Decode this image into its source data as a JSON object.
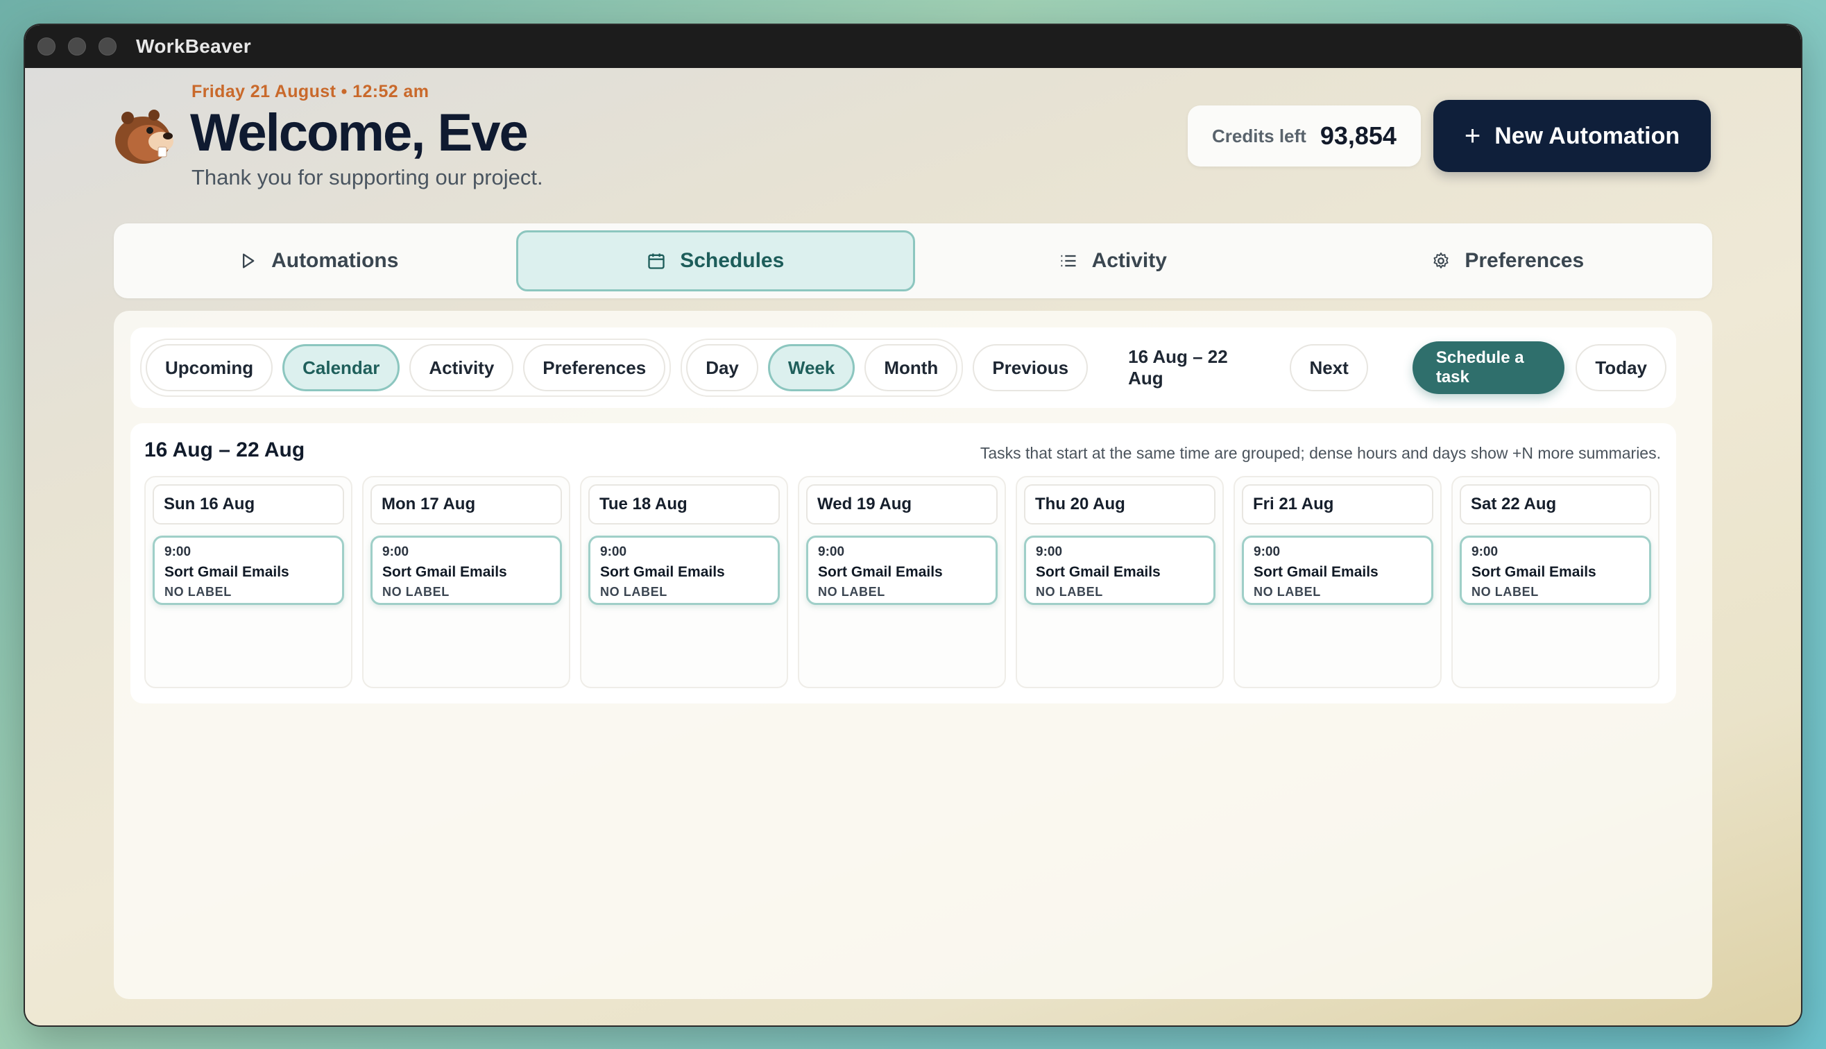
{
  "window": {
    "title": "WorkBeaver"
  },
  "header": {
    "date_line": "Friday 21 August • 12:52 am",
    "welcome": "Welcome, Eve",
    "subtitle": "Thank you for supporting our project.",
    "credits_label": "Credits left",
    "credits_value": "93,854",
    "new_automation_label": "New Automation"
  },
  "main_tabs": [
    {
      "label": "Automations",
      "icon": "play-icon"
    },
    {
      "label": "Schedules",
      "icon": "calendar-icon",
      "active": true
    },
    {
      "label": "Activity",
      "icon": "list-icon"
    },
    {
      "label": "Preferences",
      "icon": "gear-icon"
    }
  ],
  "toolbar": {
    "sub_tabs": [
      "Upcoming",
      "Calendar",
      "Activity",
      "Preferences"
    ],
    "sub_tab_active": "Calendar",
    "views": [
      "Day",
      "Week",
      "Month"
    ],
    "view_active": "Week",
    "previous_label": "Previous",
    "range_label": "16 Aug – 22 Aug",
    "next_label": "Next",
    "schedule_label": "Schedule a task",
    "today_label": "Today"
  },
  "calendar": {
    "title": "16 Aug – 22 Aug",
    "note": "Tasks that start at the same time are grouped; dense hours and days show +N more summaries.",
    "days": [
      {
        "label": "Sun 16 Aug",
        "tasks": [
          {
            "time": "9:00",
            "name": "Sort Gmail Emails",
            "tag": "NO LABEL"
          }
        ]
      },
      {
        "label": "Mon 17 Aug",
        "tasks": [
          {
            "time": "9:00",
            "name": "Sort Gmail Emails",
            "tag": "NO LABEL"
          }
        ]
      },
      {
        "label": "Tue 18 Aug",
        "tasks": [
          {
            "time": "9:00",
            "name": "Sort Gmail Emails",
            "tag": "NO LABEL"
          }
        ]
      },
      {
        "label": "Wed 19 Aug",
        "tasks": [
          {
            "time": "9:00",
            "name": "Sort Gmail Emails",
            "tag": "NO LABEL"
          }
        ]
      },
      {
        "label": "Thu 20 Aug",
        "tasks": [
          {
            "time": "9:00",
            "name": "Sort Gmail Emails",
            "tag": "NO LABEL"
          }
        ]
      },
      {
        "label": "Fri 21 Aug",
        "tasks": [
          {
            "time": "9:00",
            "name": "Sort Gmail Emails",
            "tag": "NO LABEL"
          }
        ]
      },
      {
        "label": "Sat 22 Aug",
        "tasks": [
          {
            "time": "9:00",
            "name": "Sort Gmail Emails",
            "tag": "NO LABEL"
          }
        ]
      }
    ]
  },
  "colors": {
    "accent": "#2f6f6c",
    "accent_light": "#dcf0ee",
    "primary_dark": "#0f1f3a",
    "date_orange": "#c9692b"
  }
}
